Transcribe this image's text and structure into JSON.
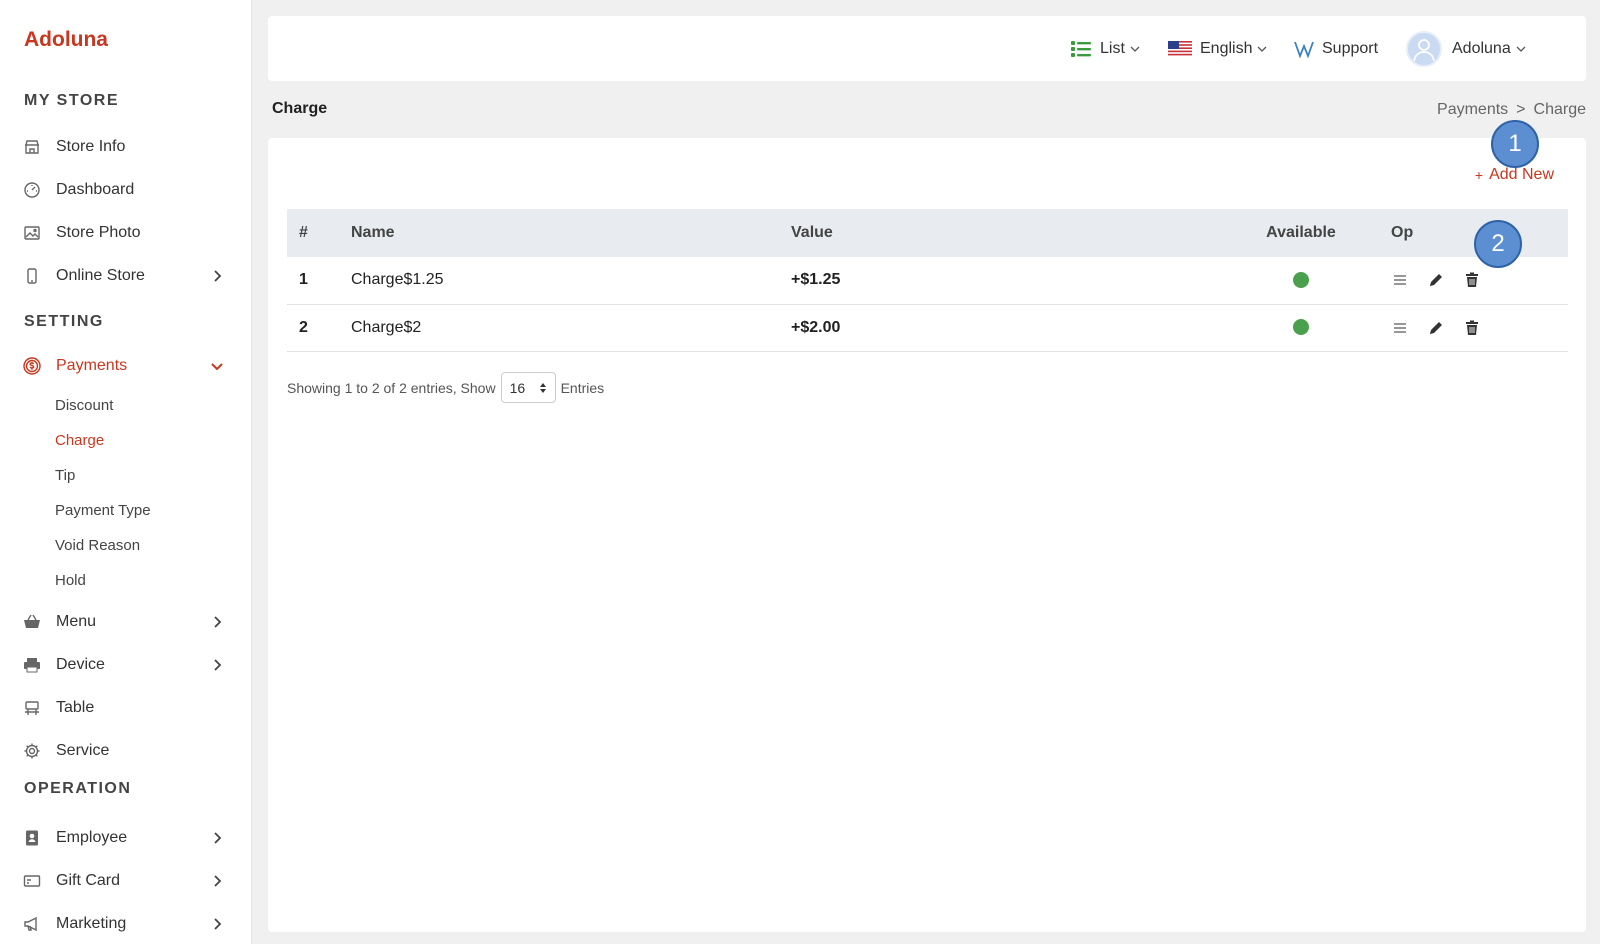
{
  "brand": "Adoluna",
  "sidebar": {
    "sections": [
      "MY STORE",
      "SETTING",
      "OPERATION"
    ],
    "my_store": [
      {
        "label": "Store Info",
        "icon": "store-icon"
      },
      {
        "label": "Dashboard",
        "icon": "dashboard-icon"
      },
      {
        "label": "Store Photo",
        "icon": "photo-icon"
      },
      {
        "label": "Online Store",
        "icon": "mobile-icon"
      }
    ],
    "payments": {
      "label": "Payments",
      "icon": "dollar-circle-icon"
    },
    "payments_sub": [
      "Discount",
      "Charge",
      "Tip",
      "Payment Type",
      "Void Reason",
      "Hold"
    ],
    "setting_rest": [
      {
        "label": "Menu",
        "icon": "basket-icon"
      },
      {
        "label": "Device",
        "icon": "printer-icon"
      },
      {
        "label": "Table",
        "icon": "table-icon"
      },
      {
        "label": "Service",
        "icon": "gear-icon"
      }
    ],
    "operation": [
      {
        "label": "Employee",
        "icon": "badge-icon"
      },
      {
        "label": "Gift Card",
        "icon": "gift-card-icon"
      },
      {
        "label": "Marketing",
        "icon": "megaphone-icon"
      }
    ]
  },
  "topbar": {
    "list_label": "List",
    "language": "English",
    "support": "Support",
    "user": "Adoluna"
  },
  "page": {
    "title": "Charge",
    "breadcrumb": [
      "Payments",
      ">",
      "Charge"
    ],
    "add_new": "Add New"
  },
  "table": {
    "headers": [
      "#",
      "Name",
      "Value",
      "Available",
      "Op"
    ],
    "rows": [
      {
        "num": "1",
        "name": "Charge$1.25",
        "value": "+$1.25",
        "available": true
      },
      {
        "num": "2",
        "name": "Charge$2",
        "value": "+$2.00",
        "available": true
      }
    ]
  },
  "footer": {
    "showing": "Showing 1 to 2 of 2 entries, Show",
    "page_size": "16",
    "entries": "Entries"
  },
  "markers": [
    "1",
    "2"
  ],
  "colors": {
    "accent": "#c8371f",
    "available": "#4aa04d",
    "marker": "#5b8fd1"
  }
}
